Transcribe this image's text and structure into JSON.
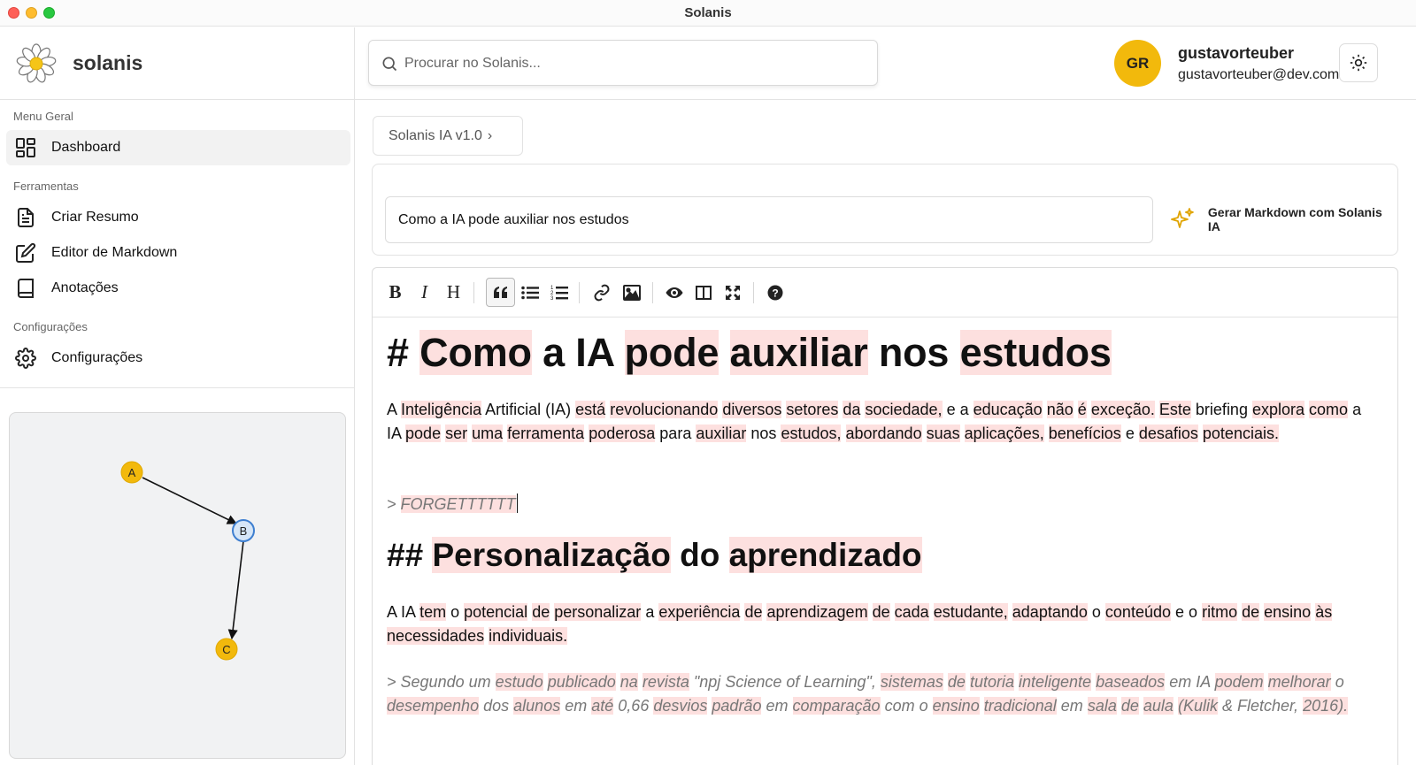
{
  "window": {
    "title": "Solanis"
  },
  "brand": {
    "name": "solanis"
  },
  "sidebar": {
    "sections": [
      {
        "label": "Menu Geral"
      },
      {
        "label": "Ferramentas"
      },
      {
        "label": "Configurações"
      }
    ],
    "items": [
      {
        "label": "Dashboard",
        "icon": "dashboard-icon",
        "active": true
      },
      {
        "label": "Criar Resumo",
        "icon": "document-icon"
      },
      {
        "label": "Editor de Markdown",
        "icon": "edit-icon"
      },
      {
        "label": "Anotações",
        "icon": "book-icon"
      },
      {
        "label": "Configurações",
        "icon": "gear-icon"
      }
    ],
    "graph": {
      "nodes": [
        {
          "id": "A"
        },
        {
          "id": "B"
        },
        {
          "id": "C"
        }
      ],
      "edges": [
        [
          "A",
          "B"
        ],
        [
          "B",
          "C"
        ]
      ]
    }
  },
  "header": {
    "search_placeholder": "Procurar no Solanis...",
    "user": {
      "initials": "GR",
      "name": "gustavorteuber",
      "email": "gustavorteuber@dev.com"
    }
  },
  "breadcrumb": {
    "label": "Solanis IA v1.0",
    "chevron": "›"
  },
  "prompt": {
    "value": "Como a IA pode auxiliar nos estudos",
    "generate_label": "Gerar Markdown com Solanis IA"
  },
  "toolbar": {
    "buttons": [
      "bold",
      "italic",
      "heading",
      "quote",
      "unordered-list",
      "ordered-list",
      "link",
      "image",
      "preview",
      "side-by-side",
      "fullscreen",
      "guide"
    ]
  },
  "colors": {
    "accent": "#f2b90c",
    "highlight": "#fde0df",
    "node_blue": "#d6e6f7"
  },
  "document": {
    "h1_prefix": "# ",
    "h1_words": [
      "Como",
      "a",
      "IA",
      "pode",
      "auxiliar",
      "nos",
      "estudos"
    ],
    "p1": [
      [
        "A",
        0
      ],
      [
        "Inteligência",
        1
      ],
      [
        "Artificial",
        0
      ],
      [
        "(IA)",
        0
      ],
      [
        "está",
        1
      ],
      [
        "revolucionando",
        1
      ],
      [
        "diversos",
        1
      ],
      [
        "setores",
        1
      ],
      [
        "da",
        1
      ],
      [
        "sociedade,",
        1
      ],
      [
        "e",
        0
      ],
      [
        "a",
        0
      ],
      [
        "educação",
        1
      ],
      [
        "não",
        1
      ],
      [
        "é",
        1
      ],
      [
        "exceção.",
        1
      ],
      [
        "Este",
        1
      ],
      [
        "briefing",
        0
      ],
      [
        "explora",
        1
      ],
      [
        "como",
        1
      ],
      [
        "a",
        0
      ],
      [
        "IA",
        0
      ],
      [
        "pode",
        1
      ],
      [
        "ser",
        1
      ],
      [
        "uma",
        1
      ],
      [
        "ferramenta",
        1
      ],
      [
        "poderosa",
        1
      ],
      [
        "para",
        0
      ],
      [
        "auxiliar",
        1
      ],
      [
        "nos",
        0
      ],
      [
        "estudos,",
        1
      ],
      [
        "abordando",
        1
      ],
      [
        "suas",
        1
      ],
      [
        "aplicações,",
        1
      ],
      [
        "benefícios",
        1
      ],
      [
        "e",
        0
      ],
      [
        "desafios",
        1
      ],
      [
        "potenciais.",
        1
      ]
    ],
    "quote1_prefix": "> ",
    "quote1_text": "FORGETTTTTT",
    "h2_prefix": "## ",
    "h2_words": [
      "Personalização",
      "do",
      "aprendizado"
    ],
    "p2": [
      [
        "A",
        0
      ],
      [
        "IA",
        0
      ],
      [
        "tem",
        1
      ],
      [
        "o",
        0
      ],
      [
        "potencial",
        1
      ],
      [
        "de",
        1
      ],
      [
        "personalizar",
        1
      ],
      [
        "a",
        0
      ],
      [
        "experiência",
        1
      ],
      [
        "de",
        1
      ],
      [
        "aprendizagem",
        1
      ],
      [
        "de",
        1
      ],
      [
        "cada",
        1
      ],
      [
        "estudante,",
        1
      ],
      [
        "adaptando",
        1
      ],
      [
        "o",
        0
      ],
      [
        "conteúdo",
        1
      ],
      [
        "e",
        0
      ],
      [
        "o",
        0
      ],
      [
        "ritmo",
        1
      ],
      [
        "de",
        1
      ],
      [
        "ensino",
        1
      ],
      [
        "às",
        1
      ],
      [
        "necessidades",
        1
      ],
      [
        "individuais.",
        1
      ]
    ],
    "quote2": [
      [
        ">",
        0
      ],
      [
        "Segundo",
        0
      ],
      [
        "um",
        0
      ],
      [
        "estudo",
        1
      ],
      [
        "publicado",
        1
      ],
      [
        "na",
        1
      ],
      [
        "revista",
        1
      ],
      [
        "\"npj",
        0
      ],
      [
        "Science",
        0
      ],
      [
        "of",
        0
      ],
      [
        "Learning\",",
        0
      ],
      [
        "sistemas",
        1
      ],
      [
        "de",
        1
      ],
      [
        "tutoria",
        1
      ],
      [
        "inteligente",
        1
      ],
      [
        "baseados",
        1
      ],
      [
        "em",
        0
      ],
      [
        "IA",
        0
      ],
      [
        "podem",
        1
      ],
      [
        "melhorar",
        1
      ],
      [
        "o",
        0
      ],
      [
        "desempenho",
        1
      ],
      [
        "dos",
        0
      ],
      [
        "alunos",
        1
      ],
      [
        "em",
        0
      ],
      [
        "até",
        1
      ],
      [
        "0,66",
        0
      ],
      [
        "desvios",
        1
      ],
      [
        "padrão",
        1
      ],
      [
        "em",
        0
      ],
      [
        "comparação",
        1
      ],
      [
        "com",
        0
      ],
      [
        "o",
        0
      ],
      [
        "ensino",
        1
      ],
      [
        "tradicional",
        1
      ],
      [
        "em",
        0
      ],
      [
        "sala",
        1
      ],
      [
        "de",
        1
      ],
      [
        "aula",
        1
      ],
      [
        "(Kulik",
        1
      ],
      [
        "&",
        0
      ],
      [
        "Fletcher,",
        0
      ],
      [
        "2016).",
        1
      ]
    ]
  }
}
